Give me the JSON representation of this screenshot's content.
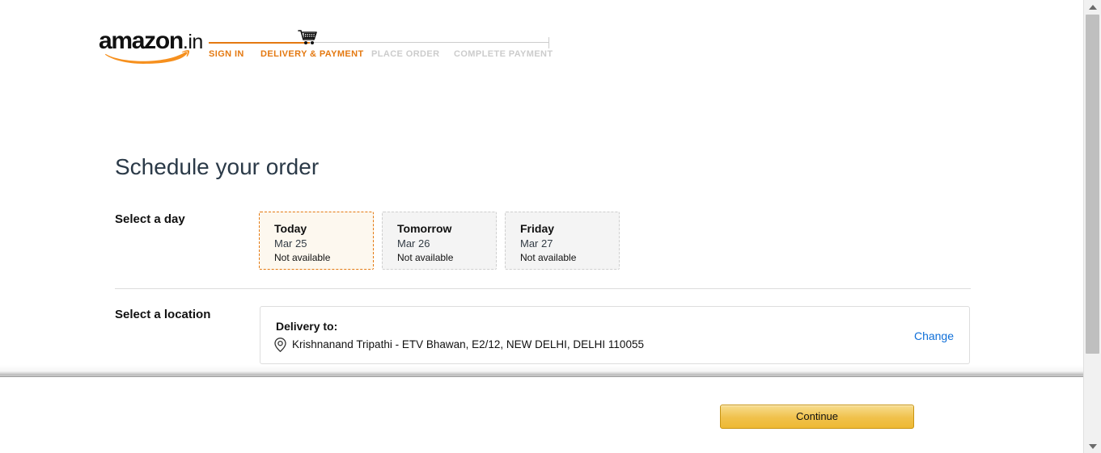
{
  "brand": {
    "name": "amazon",
    "tld": ".in",
    "accent_color": "#e47911",
    "logo_name": "amazon-in-logo"
  },
  "progress": {
    "cart_icon": "shopping-cart-icon",
    "steps": [
      {
        "label": "SIGN IN",
        "state": "done"
      },
      {
        "label": "DELIVERY & PAYMENT",
        "state": "active"
      },
      {
        "label": "PLACE ORDER",
        "state": "todo"
      },
      {
        "label": "COMPLETE PAYMENT",
        "state": "todo"
      }
    ]
  },
  "main": {
    "title": "Schedule your order",
    "day_section": {
      "label": "Select a day",
      "cards": [
        {
          "day": "Today",
          "date": "Mar 25",
          "status": "Not available",
          "selected": true
        },
        {
          "day": "Tomorrow",
          "date": "Mar 26",
          "status": "Not available",
          "selected": false
        },
        {
          "day": "Friday",
          "date": "Mar 27",
          "status": "Not available",
          "selected": false
        }
      ]
    },
    "location_section": {
      "label": "Select a location",
      "delivery_title": "Delivery to:",
      "pin_icon": "map-pin-icon",
      "address": "Krishnanand Tripathi - ETV Bhawan, E2/12, NEW DELHI, DELHI 110055",
      "change_label": "Change",
      "change_color": "#0f6fd8"
    }
  },
  "footer": {
    "continue_label": "Continue"
  },
  "scrollbar": {
    "up_icon": "scroll-up-arrow-icon",
    "down_icon": "scroll-down-arrow-icon"
  }
}
